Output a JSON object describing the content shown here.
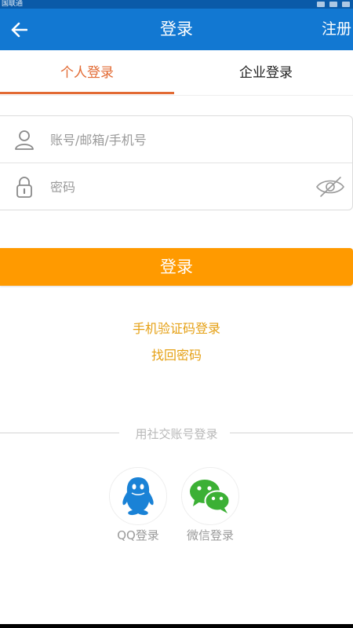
{
  "status_bar": {
    "carrier": "国联通"
  },
  "header": {
    "title": "登录",
    "register_label": "注册",
    "back_icon": "arrow-left-icon",
    "color": "#1278d2"
  },
  "tabs": [
    {
      "label": "个人登录",
      "active": true
    },
    {
      "label": "企业登录",
      "active": false
    }
  ],
  "accent_color": "#e26a33",
  "form": {
    "account": {
      "placeholder": "账号/邮箱/手机号",
      "value": "",
      "icon": "user-icon"
    },
    "password": {
      "placeholder": "密码",
      "value": "",
      "icon": "lock-icon",
      "toggle_icon": "eye-off-icon"
    }
  },
  "login_button": {
    "label": "登录",
    "color": "#ff9a00"
  },
  "links": {
    "sms_login": "手机验证码登录",
    "forgot_password": "找回密码",
    "color": "#e5a014"
  },
  "social": {
    "divider_text": "用社交账号登录",
    "items": [
      {
        "label": "QQ登录",
        "icon": "qq-icon"
      },
      {
        "label": "微信登录",
        "icon": "wechat-icon"
      }
    ]
  }
}
